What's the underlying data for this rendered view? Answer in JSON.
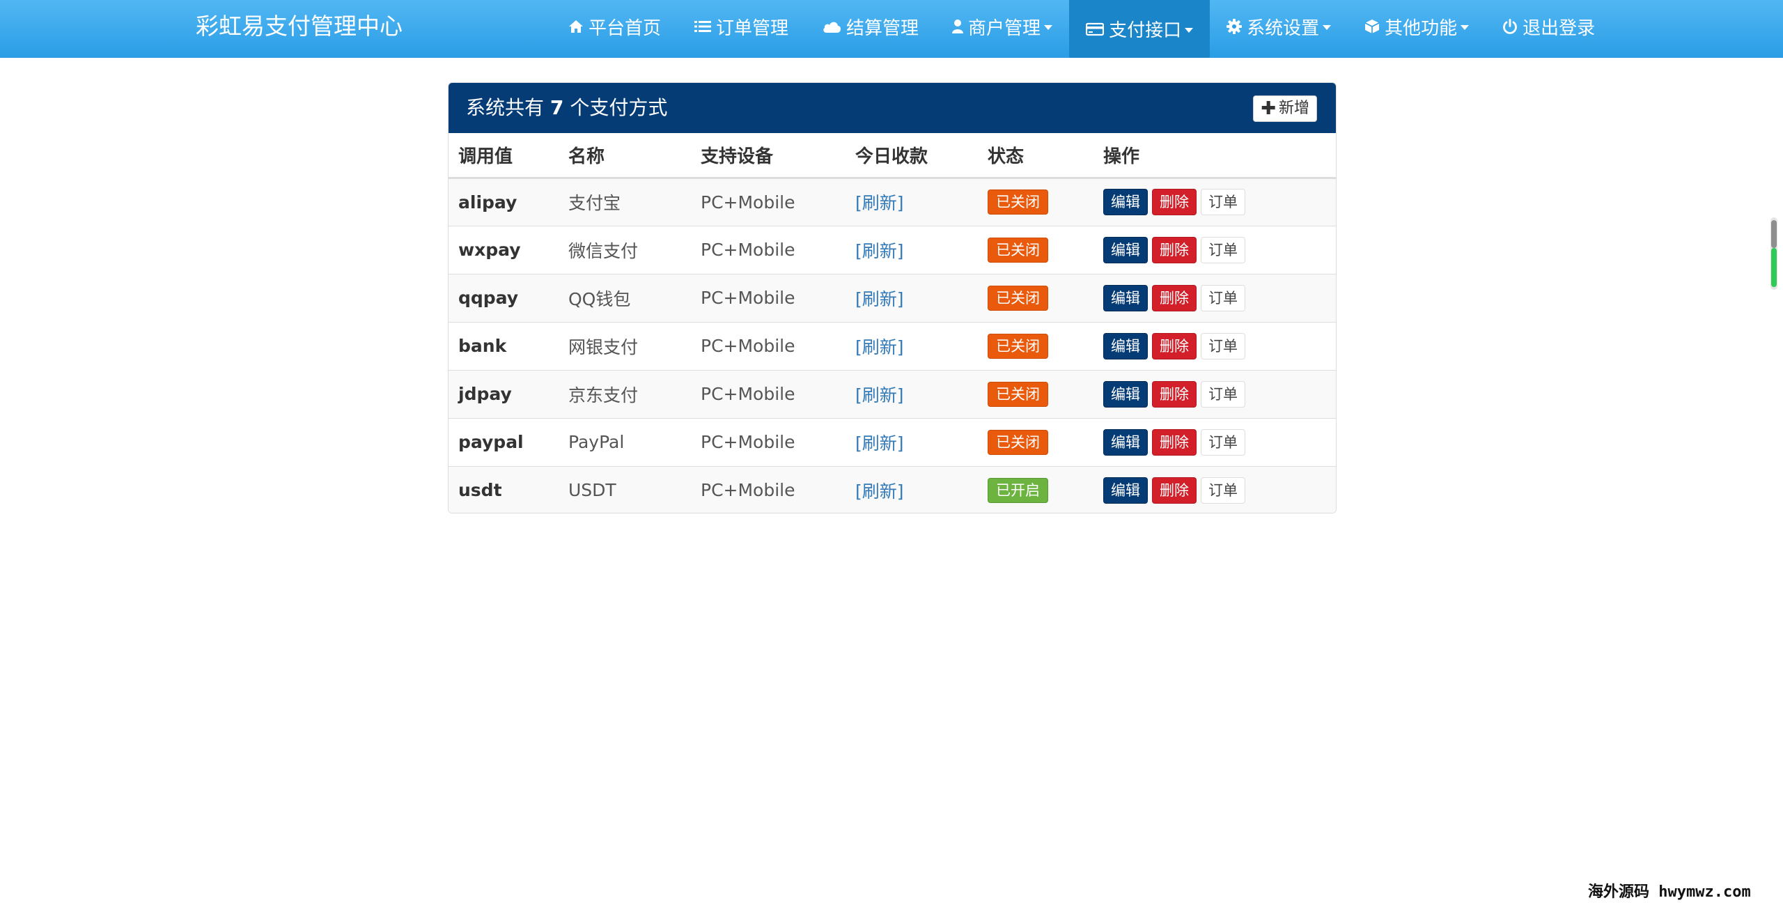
{
  "app": {
    "brand": "彩虹易支付管理中心"
  },
  "nav": {
    "items": [
      {
        "label": "平台首页",
        "icon": "home-icon",
        "dropdown": false,
        "active": false
      },
      {
        "label": "订单管理",
        "icon": "list-icon",
        "dropdown": false,
        "active": false
      },
      {
        "label": "结算管理",
        "icon": "cloud-icon",
        "dropdown": false,
        "active": false
      },
      {
        "label": "商户管理",
        "icon": "user-icon",
        "dropdown": true,
        "active": false
      },
      {
        "label": "支付接口",
        "icon": "credit-card-icon",
        "dropdown": true,
        "active": true
      },
      {
        "label": "系统设置",
        "icon": "gear-icon",
        "dropdown": true,
        "active": false
      },
      {
        "label": "其他功能",
        "icon": "cube-icon",
        "dropdown": true,
        "active": false
      },
      {
        "label": "退出登录",
        "icon": "power-icon",
        "dropdown": false,
        "active": false
      }
    ]
  },
  "panel": {
    "title_prefix": "系统共有",
    "count": "7",
    "title_suffix": "个支付方式",
    "add_label": "新增"
  },
  "table": {
    "columns": [
      "调用值",
      "名称",
      "支持设备",
      "今日收款",
      "状态",
      "操作"
    ],
    "refresh_label": "[刷新]",
    "edit_label": "编辑",
    "delete_label": "删除",
    "order_label": "订单",
    "rows": [
      {
        "code": "alipay",
        "name": "支付宝",
        "device": "PC+Mobile",
        "status": "已关闭",
        "enabled": false
      },
      {
        "code": "wxpay",
        "name": "微信支付",
        "device": "PC+Mobile",
        "status": "已关闭",
        "enabled": false
      },
      {
        "code": "qqpay",
        "name": "QQ钱包",
        "device": "PC+Mobile",
        "status": "已关闭",
        "enabled": false
      },
      {
        "code": "bank",
        "name": "网银支付",
        "device": "PC+Mobile",
        "status": "已关闭",
        "enabled": false
      },
      {
        "code": "jdpay",
        "name": "京东支付",
        "device": "PC+Mobile",
        "status": "已关闭",
        "enabled": false
      },
      {
        "code": "paypal",
        "name": "PayPal",
        "device": "PC+Mobile",
        "status": "已关闭",
        "enabled": false
      },
      {
        "code": "usdt",
        "name": "USDT",
        "device": "PC+Mobile",
        "status": "已开启",
        "enabled": true
      }
    ]
  },
  "colors": {
    "navbar": "#2a9de6",
    "panel_header": "#063c75",
    "status_off": "#e95a0c",
    "status_on": "#6cb33f",
    "delete": "#d21f2a",
    "link": "#337ab7"
  },
  "watermark": "海外源码 hwymwz.com"
}
